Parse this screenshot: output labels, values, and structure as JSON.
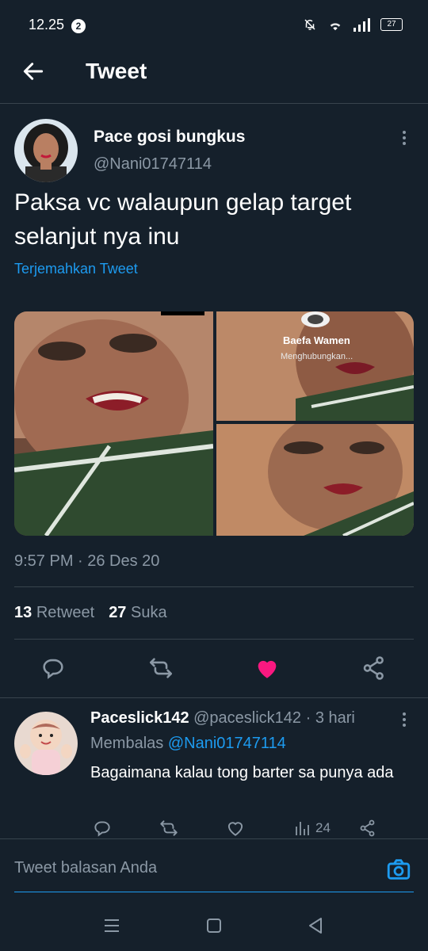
{
  "status_bar": {
    "time": "12.25",
    "notification_count": "2",
    "battery": "27"
  },
  "header": {
    "title": "Tweet"
  },
  "tweet": {
    "author_name": "Pace gosi bungkus",
    "author_handle": "@Nani01747114",
    "text": "Paksa vc walaupun gelap target selanjut nya inu",
    "translate_label": "Terjemahkan Tweet",
    "media": {
      "call_name": "Baefa Wamen",
      "call_status": "Menghubungkan..."
    },
    "timestamp": "9:57 PM · 26 Des 20",
    "retweet_count": "13",
    "retweet_label": "Retweet",
    "like_count": "27",
    "like_label": "Suka"
  },
  "reply": {
    "author_name": "Paceslick142",
    "author_handle": "@paceslick142",
    "time_ago": "· 3 hari",
    "replying_prefix": "Membalas",
    "replying_to": "@Nani01747114",
    "text": "Bagaimana kalau tong barter sa punya ada",
    "views": "24"
  },
  "compose": {
    "placeholder": "Tweet balasan Anda"
  },
  "colors": {
    "background": "#15202b",
    "accent": "#1d9bf0",
    "like": "#f91880",
    "muted": "#8b98a5"
  }
}
